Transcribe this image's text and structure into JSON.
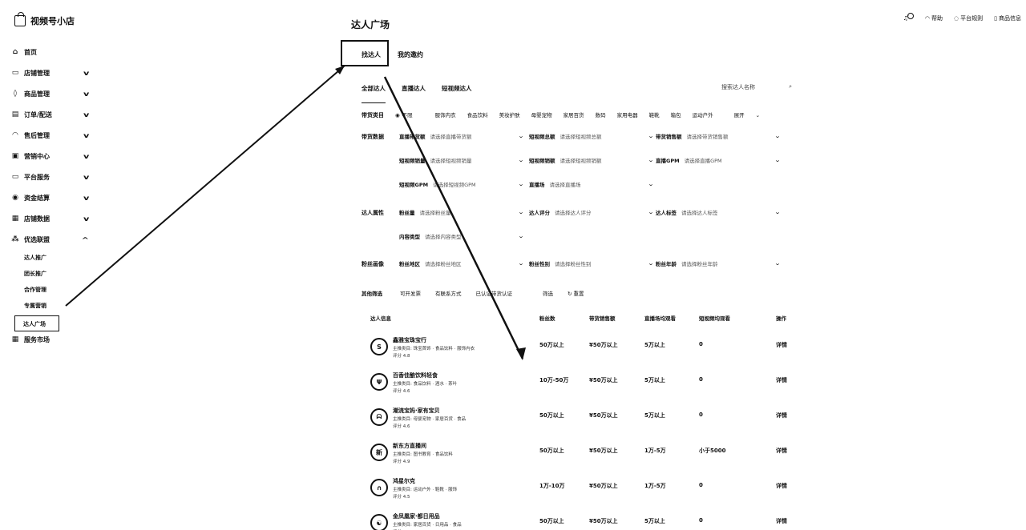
{
  "brand": {
    "name": "视频号小店"
  },
  "sidebar": {
    "items": [
      {
        "label": "首页",
        "icon": "home-icon",
        "glyph": "⌂",
        "expandable": false
      },
      {
        "label": "店铺管理",
        "icon": "store-icon",
        "glyph": "▭",
        "expandable": true
      },
      {
        "label": "商品管理",
        "icon": "bag-icon",
        "glyph": "◊",
        "expandable": true
      },
      {
        "label": "订单/配送",
        "icon": "clipboard-icon",
        "glyph": "▤",
        "expandable": true
      },
      {
        "label": "售后管理",
        "icon": "headset-icon",
        "glyph": "◠",
        "expandable": true
      },
      {
        "label": "营销中心",
        "icon": "ticket-icon",
        "glyph": "▣",
        "expandable": true
      },
      {
        "label": "平台服务",
        "icon": "service-icon",
        "glyph": "▭",
        "expandable": true
      },
      {
        "label": "资金结算",
        "icon": "money-icon",
        "glyph": "◉",
        "expandable": true
      },
      {
        "label": "店铺数据",
        "icon": "chart-icon",
        "glyph": "▦",
        "expandable": true
      },
      {
        "label": "优选联盟",
        "icon": "network-icon",
        "glyph": "⁂",
        "expandable": true,
        "expanded": true
      }
    ],
    "sub_items": [
      "达人推广",
      "团长推广",
      "合作管理",
      "专属营销",
      "达人广场"
    ],
    "last_item": {
      "label": "服务市场",
      "icon": "market-icon",
      "glyph": "▦"
    }
  },
  "topbar": {
    "help": "帮助",
    "platform": "平台规则",
    "account": "商品信息"
  },
  "page": {
    "title": "达人广场",
    "tabs": [
      "找达人",
      "我的邀约"
    ],
    "subtabs": [
      "全部达人",
      "直播达人",
      "短视频达人"
    ],
    "search_placeholder": "搜索达人名称"
  },
  "filters": {
    "category_label": "带货类目",
    "categories": [
      "不限",
      "服饰内衣",
      "食品饮料",
      "美妆护肤",
      "母婴宠物",
      "家居百货",
      "数码",
      "家用电器",
      "鞋靴",
      "箱包",
      "运动户外"
    ],
    "expand": "展开",
    "data_label": "带货数据",
    "attr_label": "达人属性",
    "fans_label": "粉丝画像",
    "selects": [
      {
        "label": "直播带货额",
        "ph": "请选择直播带货额"
      },
      {
        "label": "短视频总额",
        "ph": "请选择短视频总额"
      },
      {
        "label": "带货销售额",
        "ph": "请选择带货销售额"
      },
      {
        "label": "短视频销量",
        "ph": "请选择短视频销量"
      },
      {
        "label": "短视频销额",
        "ph": "请选择短视频销额"
      },
      {
        "label": "直播GPM",
        "ph": "请选择直播GPM"
      },
      {
        "label": "短视频GPM",
        "ph": "请选择短视频GPM"
      },
      {
        "label": "直播场",
        "ph": "请选择直播场"
      },
      {
        "label": "粉丝量",
        "ph": "请选择粉丝量"
      },
      {
        "label": "达人评分",
        "ph": "请选择达人评分"
      },
      {
        "label": "达人标签",
        "ph": "请选择达人标签"
      },
      {
        "label": "内容类型",
        "ph": "请选择内容类型"
      },
      {
        "label": "粉丝地区",
        "ph": "请选择粉丝地区"
      },
      {
        "label": "粉丝性别",
        "ph": "请选择粉丝性别"
      },
      {
        "label": "粉丝年龄",
        "ph": "请选择粉丝年龄"
      }
    ],
    "other_label": "其他筛选",
    "other_opts": [
      "可开发票",
      "有联系方式",
      "已认证带货认证"
    ],
    "apply": "筛选",
    "reset": "重置"
  },
  "table": {
    "headers": [
      "达人信息",
      "粉丝数",
      "带货销售额",
      "直播场均观看",
      "短视频均观看",
      "操作"
    ],
    "rows": [
      {
        "name": "鑫雅宝珠宝行",
        "desc": "主推类目: 珠宝首饰 · 食品饮料 · 服饰内衣",
        "score": "评分 4.8",
        "avatar": "S",
        "fans": "50万以上",
        "sales": "¥50万以上",
        "live": "5万以上",
        "video": "0",
        "op": "详情"
      },
      {
        "name": "百香佳酿饮料轻食",
        "desc": "主推类目: 食品饮料 · 酒水 · 茶叶",
        "score": "评分 4.6",
        "avatar": "Ψ",
        "fans": "10万-50万",
        "sales": "¥50万以上",
        "live": "5万以上",
        "video": "0",
        "op": "详情"
      },
      {
        "name": "潮流宝妈·家有宝贝",
        "desc": "主推类目: 母婴宠物 · 家居百货 · 食品",
        "score": "评分 4.6",
        "avatar": "ᗣ",
        "fans": "50万以上",
        "sales": "¥50万以上",
        "live": "5万以上",
        "video": "0",
        "op": "详情"
      },
      {
        "name": "新东方直播间",
        "desc": "主推类目: 图书教育 · 食品饮料",
        "score": "评分 4.9",
        "avatar": "新",
        "fans": "50万以上",
        "sales": "¥50万以上",
        "live": "1万-5万",
        "video": "小于5000",
        "op": "详情"
      },
      {
        "name": "鸿星尔克",
        "desc": "主推类目: 运动户外 · 鞋靴 · 服饰",
        "score": "评分 4.5",
        "avatar": "∩",
        "fans": "1万-10万",
        "sales": "¥50万以上",
        "live": "1万-5万",
        "video": "0",
        "op": "详情"
      },
      {
        "name": "金凤凰家·都日用品",
        "desc": "主推类目: 家居百货 · 日用品 · 食品",
        "score": "评分 4.8",
        "avatar": "☯",
        "fans": "50万以上",
        "sales": "¥50万以上",
        "live": "5万以上",
        "video": "0",
        "op": "详情"
      }
    ]
  }
}
